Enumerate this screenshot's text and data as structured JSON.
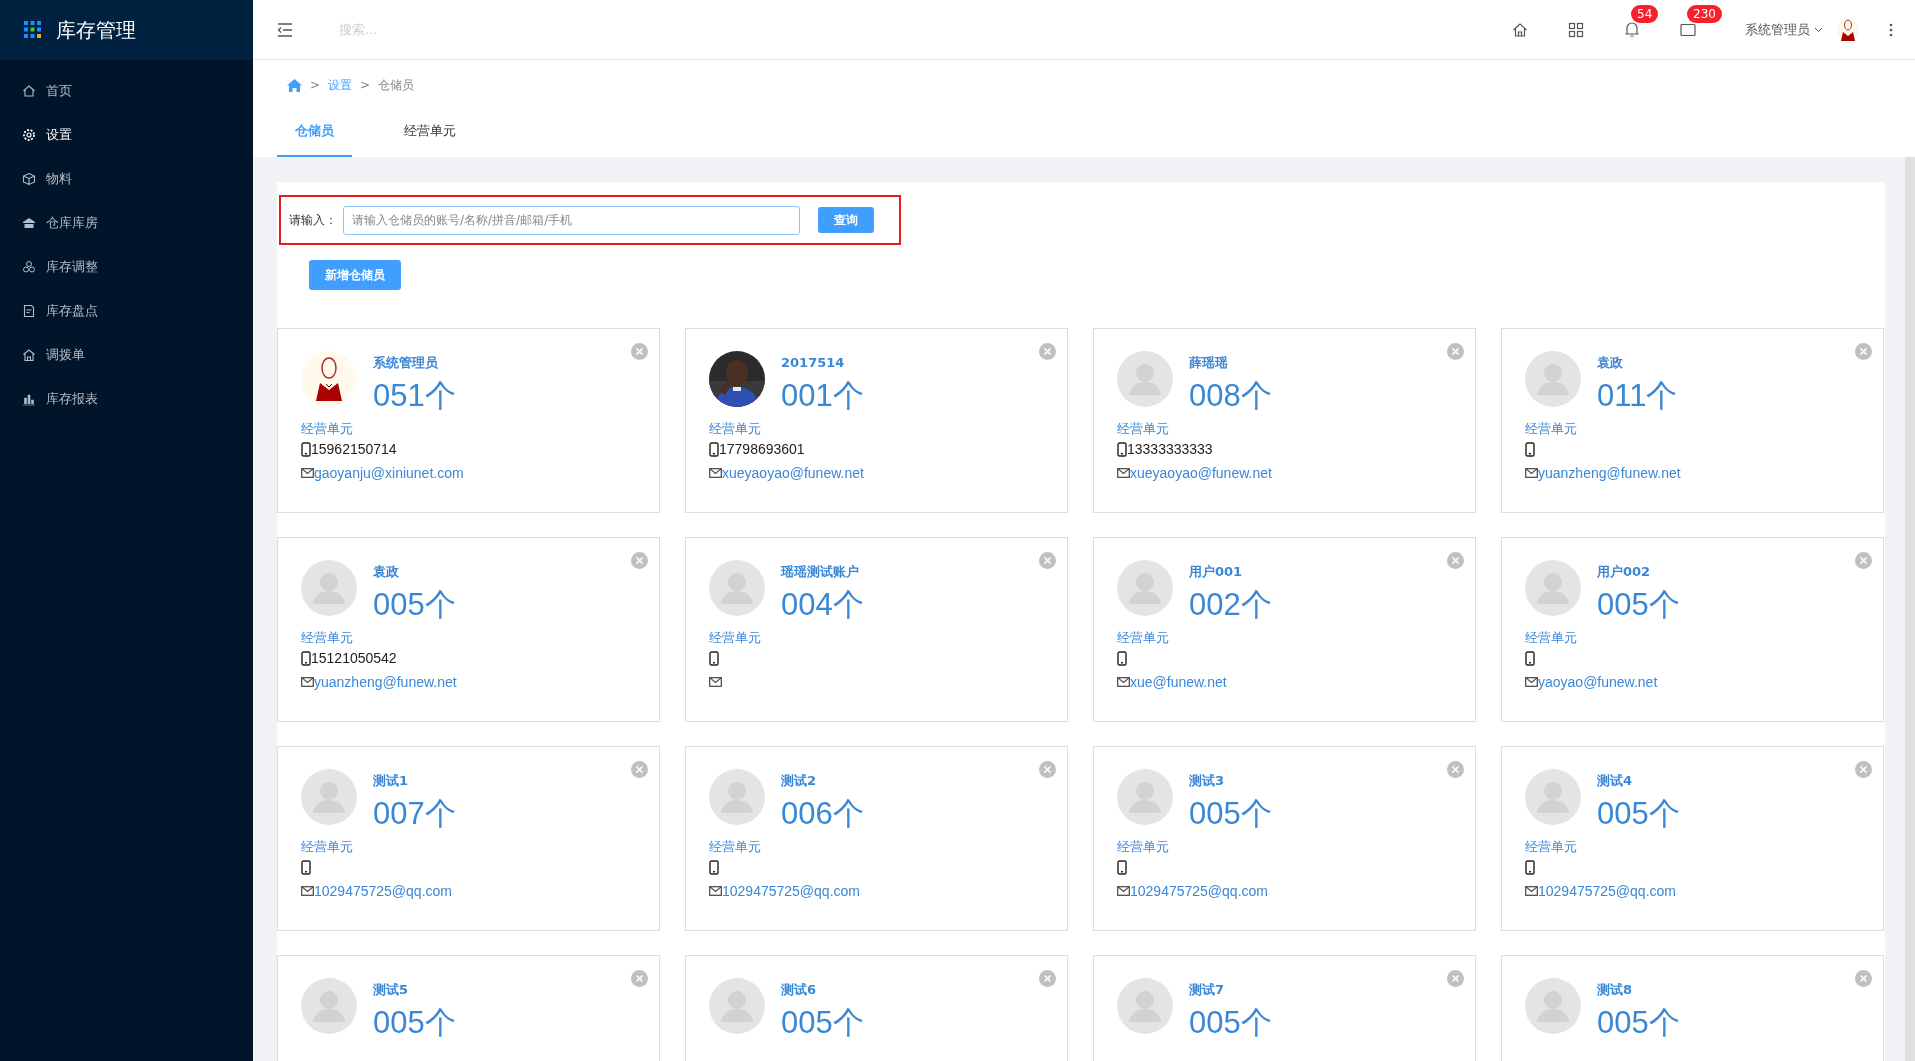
{
  "sidebar": {
    "title": "库存管理",
    "items": [
      {
        "label": "首页",
        "selected": false
      },
      {
        "label": "设置",
        "selected": true
      },
      {
        "label": "物料",
        "selected": false
      },
      {
        "label": "仓库库房",
        "selected": false
      },
      {
        "label": "库存调整",
        "selected": false
      },
      {
        "label": "库存盘点",
        "selected": false
      },
      {
        "label": "调拨单",
        "selected": false
      },
      {
        "label": "库存报表",
        "selected": false
      }
    ]
  },
  "topbar": {
    "search": {
      "placeholder": "搜索..."
    },
    "notifications": "54",
    "messages": "230",
    "user": "系统管理员"
  },
  "breadcrumb": [
    {
      "separator": ">",
      "label": "设置"
    },
    {
      "separator": ">",
      "label": "仓储员"
    }
  ],
  "tabs": [
    {
      "label": "仓储员",
      "selected": true
    },
    {
      "label": "经营单元",
      "selected": false
    }
  ],
  "search": {
    "label": "请输入：",
    "placeholder": "请输入仓储员的账号/名称/拼音/邮箱/手机",
    "button": "查询"
  },
  "add_button": "新增仓储员",
  "cards": [
    {
      "kind": "admin",
      "name": "系统管理员",
      "count": "051个",
      "unit": "经营单元",
      "phone": "15962150714",
      "email": "gaoyanju@xiniunet.com"
    },
    {
      "name": "2017514",
      "count": "001个",
      "unit": "经营单元",
      "phone": "17798693601",
      "email": "xueyaoyao@funew.net"
    },
    {
      "kind": "default",
      "name": "薛瑶瑶",
      "count": "008个",
      "unit": "经营单元",
      "phone": "13333333333",
      "email": "xueyaoyao@funew.net"
    },
    {
      "kind": "default",
      "name": "袁政",
      "count": "011个",
      "unit": "经营单元",
      "email": "yuanzheng@funew.net"
    },
    {
      "kind": "default",
      "name": "袁政",
      "count": "005个",
      "unit": "经营单元",
      "phone": "15121050542",
      "email": "yuanzheng@funew.net"
    },
    {
      "kind": "default",
      "name": "瑶瑶测试账户",
      "count": "004个",
      "unit": "经营单元"
    },
    {
      "kind": "default",
      "name": "用户001",
      "count": "002个",
      "unit": "经营单元",
      "email": "xue@funew.net"
    },
    {
      "kind": "default",
      "name": "用户002",
      "count": "005个",
      "unit": "经营单元",
      "email": "yaoyao@funew.net"
    },
    {
      "kind": "default",
      "name": "测试1",
      "count": "007个",
      "unit": "经营单元",
      "email": "1029475725@qq.com"
    },
    {
      "kind": "default",
      "name": "测试2",
      "count": "006个",
      "unit": "经营单元",
      "email": "1029475725@qq.com"
    },
    {
      "kind": "default",
      "name": "测试3",
      "count": "005个",
      "unit": "经营单元",
      "email": "1029475725@qq.com"
    },
    {
      "kind": "default",
      "name": "测试4",
      "count": "005个",
      "unit": "经营单元",
      "email": "1029475725@qq.com"
    },
    {
      "kind": "default",
      "name": "测试5",
      "count": "005个"
    },
    {
      "kind": "default",
      "name": "测试6",
      "count": "005个"
    },
    {
      "kind": "default",
      "name": "测试7",
      "count": "005个"
    },
    {
      "kind": "default",
      "name": "测试8",
      "count": "005个"
    }
  ]
}
